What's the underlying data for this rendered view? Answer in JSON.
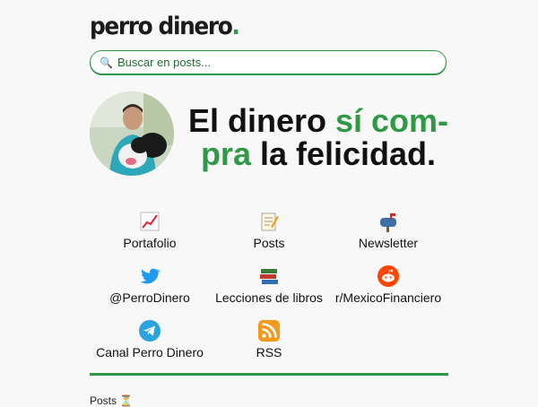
{
  "brand": {
    "name": "perro dinero",
    "dot": "."
  },
  "search": {
    "placeholder": "Buscar en posts..."
  },
  "hero": {
    "line_a": "El dinero ",
    "line_b": "sí com-",
    "line_c": "pra",
    "line_d": " la felicidad."
  },
  "links": [
    {
      "label": "Portafolio",
      "icon": "chart-icon"
    },
    {
      "label": "Posts",
      "icon": "memo-icon"
    },
    {
      "label": "Newsletter",
      "icon": "mailbox-icon"
    },
    {
      "label": "@PerroDinero",
      "icon": "twitter-icon"
    },
    {
      "label": "Lecciones de libros",
      "icon": "books-icon"
    },
    {
      "label": "r/MexicoFinanciero",
      "icon": "reddit-icon"
    },
    {
      "label": "Canal Perro Dinero",
      "icon": "telegram-icon"
    },
    {
      "label": "RSS",
      "icon": "rss-icon"
    }
  ],
  "footer": {
    "posts_label": "Posts"
  },
  "colors": {
    "accent": "#2f9945",
    "twitter": "#1d9bf0",
    "reddit": "#ff4500",
    "telegram": "#2aa3df",
    "rss": "#f39a1e"
  }
}
